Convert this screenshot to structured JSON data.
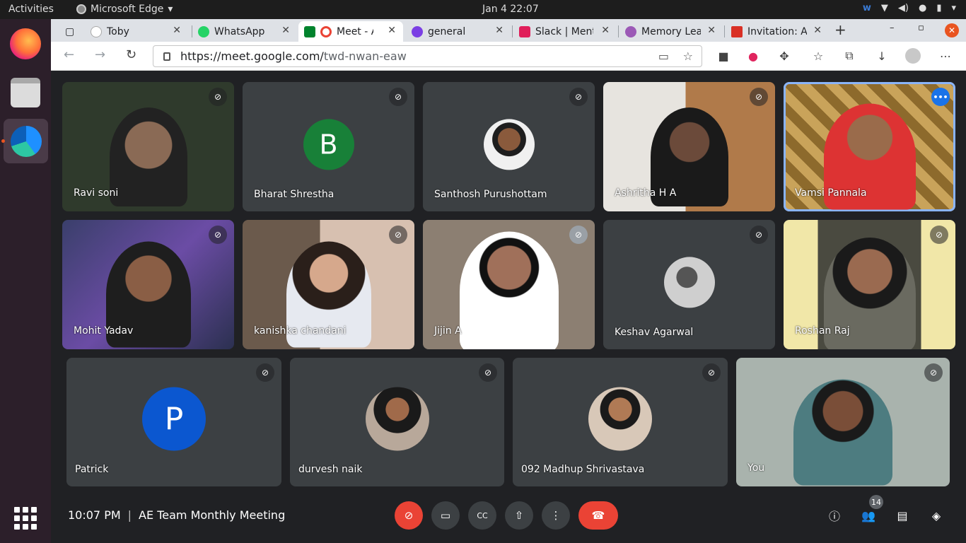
{
  "os": {
    "activities": "Activities",
    "app_name": "Microsoft Edge",
    "clock": "Jan 4  22:07"
  },
  "browser": {
    "tabs": [
      {
        "title": "Toby",
        "favicon_color": "#ffffff"
      },
      {
        "title": "WhatsApp",
        "favicon_color": "#25d366"
      },
      {
        "title": "Meet - AE",
        "favicon_color": "#ea4335"
      },
      {
        "title": "general",
        "favicon_color": "#7b3fe4"
      },
      {
        "title": "Slack | Mentio",
        "favicon_color": "#e01e5a"
      },
      {
        "title": "Memory Lea",
        "favicon_color": "#9b59b6"
      },
      {
        "title": "Invitation: A",
        "favicon_color": "#d93025"
      }
    ],
    "url_host": "https://meet.google.com/",
    "url_path": "twd-nwan-eaw"
  },
  "meet": {
    "participants": [
      {
        "name": "Ravi soni",
        "type": "video",
        "bg": "#2f3a2c"
      },
      {
        "name": "Bharat Shrestha",
        "type": "initial",
        "initial": "B",
        "color": "#188038"
      },
      {
        "name": "Santhosh Purushottam",
        "type": "photo"
      },
      {
        "name": "Ashritha H A",
        "type": "video",
        "bg": "#c9b7a0"
      },
      {
        "name": "Vamsi Pannala",
        "type": "video",
        "bg": "#b5914f"
      },
      {
        "name": "Mohit Yadav",
        "type": "video",
        "bg": "#3a3f6b"
      },
      {
        "name": "kanishka chandani",
        "type": "video",
        "bg": "#b99a86"
      },
      {
        "name": "Jijin A",
        "type": "video",
        "bg": "#8c7f72"
      },
      {
        "name": "Keshav Agarwal",
        "type": "photo"
      },
      {
        "name": "Roshan Raj",
        "type": "video",
        "bg": "#5a5a4a"
      },
      {
        "name": "Patrick",
        "type": "initial",
        "initial": "P",
        "color": "#0b57d0"
      },
      {
        "name": "durvesh naik",
        "type": "photo"
      },
      {
        "name": "092 Madhup Shrivastava",
        "type": "photo"
      },
      {
        "name": "You",
        "type": "video",
        "bg": "#a9b3ad"
      }
    ],
    "time": "10:07 PM",
    "meeting_title": "AE Team Monthly Meeting",
    "participant_count": "14"
  }
}
